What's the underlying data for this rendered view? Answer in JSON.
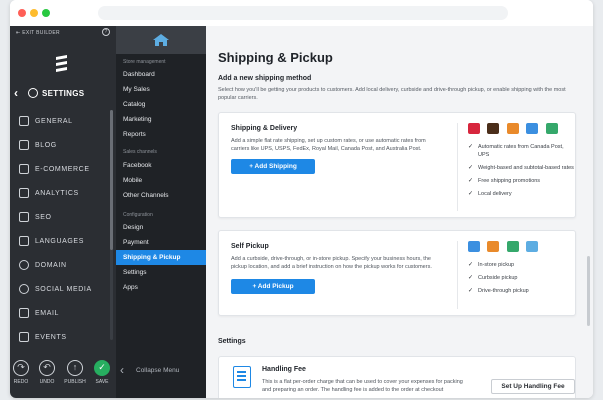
{
  "window": {
    "dots": [
      "#ff5f57",
      "#febc2e",
      "#28c840"
    ]
  },
  "sidebar": {
    "exit_builder": "EXIT BUILDER",
    "help": "?",
    "settings_label": "SETTINGS",
    "items": [
      {
        "label": "GENERAL",
        "icon": "wrench-icon"
      },
      {
        "label": "BLOG",
        "icon": "blog-icon"
      },
      {
        "label": "E-COMMERCE",
        "icon": "cart-icon"
      },
      {
        "label": "ANALYTICS",
        "icon": "analytics-icon"
      },
      {
        "label": "SEO",
        "icon": "seo-icon"
      },
      {
        "label": "LANGUAGES",
        "icon": "languages-icon"
      },
      {
        "label": "DOMAIN",
        "icon": "globe-icon"
      },
      {
        "label": "SOCIAL MEDIA",
        "icon": "social-icon"
      },
      {
        "label": "EMAIL",
        "icon": "email-icon"
      },
      {
        "label": "EVENTS",
        "icon": "calendar-icon"
      }
    ],
    "bottom": {
      "redo": "REDO",
      "undo": "UNDO",
      "publish": "PUBLISH",
      "save": "SAVE"
    }
  },
  "store_nav": {
    "sections": {
      "store_management": "Store management",
      "sales_channels": "Sales channels",
      "configuration": "Configuration"
    },
    "items": {
      "dashboard": "Dashboard",
      "my_sales": "My Sales",
      "catalog": "Catalog",
      "marketing": "Marketing",
      "reports": "Reports",
      "facebook": "Facebook",
      "mobile": "Mobile",
      "other_channels": "Other Channels",
      "design": "Design",
      "payment": "Payment",
      "shipping_pickup": "Shipping & Pickup",
      "settings": "Settings",
      "apps": "Apps"
    },
    "collapse": "Collapse Menu"
  },
  "main": {
    "title": "Shipping & Pickup",
    "subtitle": "Add a new shipping method",
    "description": "Select how you'll be getting your products to customers. Add local delivery, curbside and drive-through pickup, or enable shipping with the most popular carriers.",
    "shipping_card": {
      "title": "Shipping & Delivery",
      "desc": "Add a simple flat rate shipping, set up custom rates, or use automatic rates from carriers like UPS, USPS, FedEx, Royal Mail, Canada Post, and Australia Post.",
      "button": "+ Add Shipping",
      "features": [
        "Automatic rates from Canada Post, UPS",
        "Weight-based and subtotal-based rates",
        "Free shipping promotions",
        "Local delivery"
      ]
    },
    "pickup_card": {
      "title": "Self Pickup",
      "desc": "Add a curbside, drive-through, or in-store pickup. Specify your business hours, the pickup location, and add a brief instruction on how the pickup works for customers.",
      "button": "+ Add Pickup",
      "features": [
        "In-store pickup",
        "Curbside pickup",
        "Drive-through pickup"
      ]
    },
    "settings_heading": "Settings",
    "handling": {
      "title": "Handling Fee",
      "desc": "This is a flat per-order charge that can be used to cover your expenses for packing and preparing an order. The handling fee is added to the order at checkout",
      "button": "Set Up Handling Fee"
    }
  }
}
